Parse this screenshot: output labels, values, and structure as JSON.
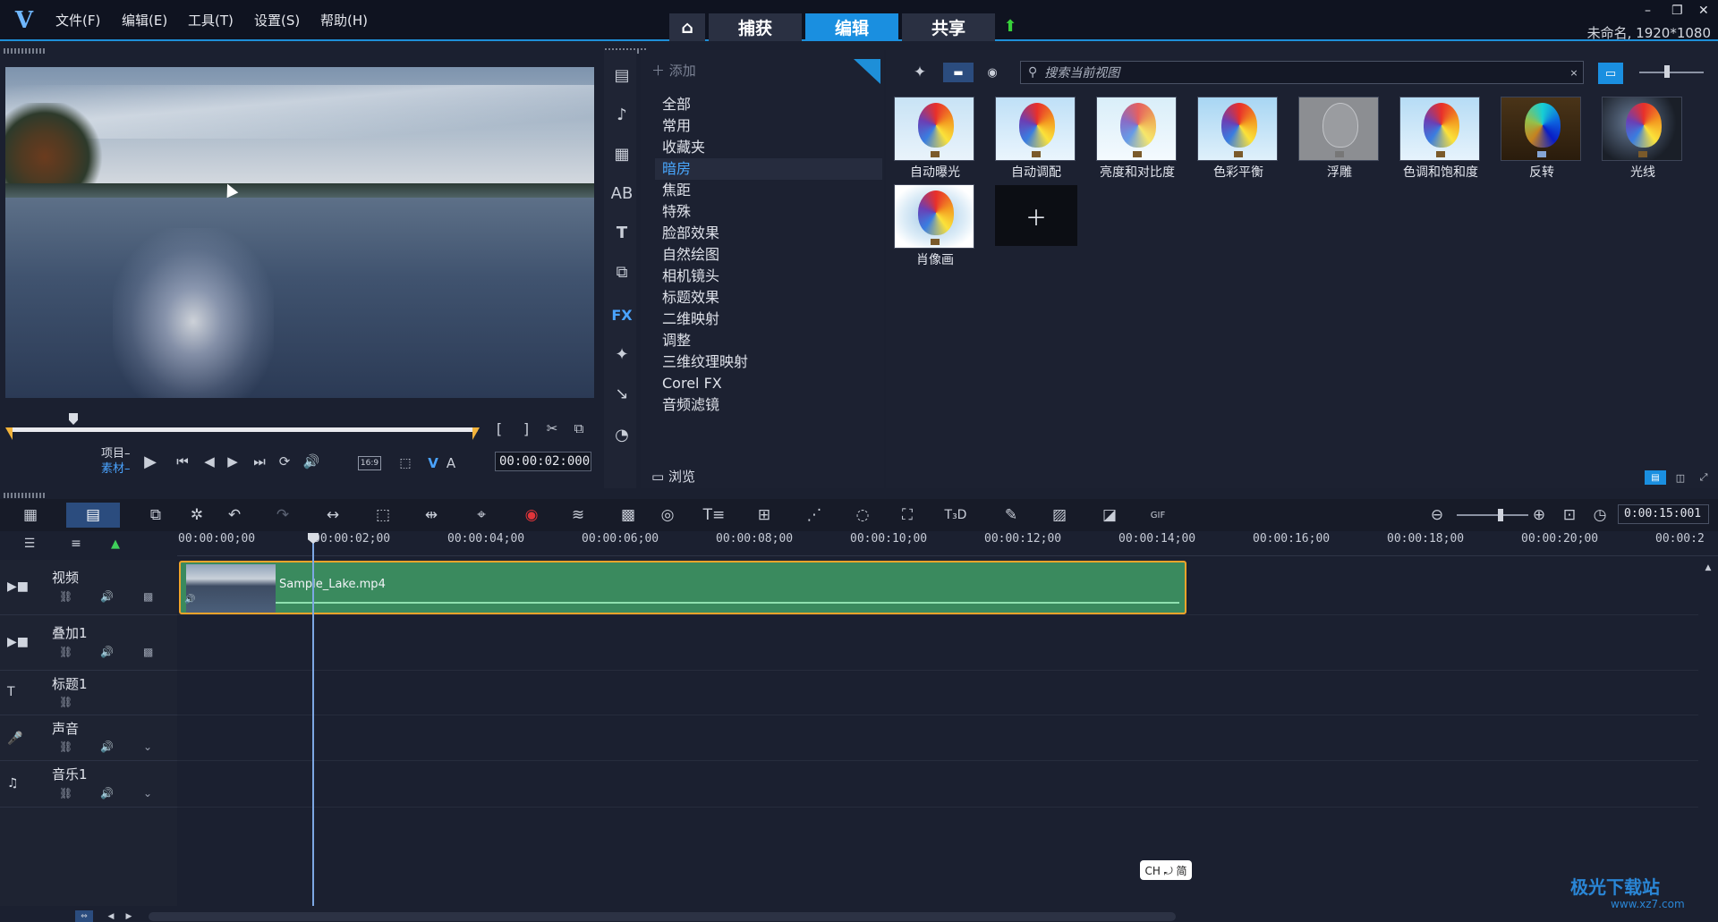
{
  "menu": [
    "文件(F)",
    "编辑(E)",
    "工具(T)",
    "设置(S)",
    "帮助(H)"
  ],
  "tabs": [
    "捕获",
    "编辑",
    "共享"
  ],
  "window_info": "未命名, 1920*1080",
  "player": {
    "project_label": "项目–",
    "clip_label": "素材–",
    "timecode": "00:00:02:000",
    "aspect": "16:9"
  },
  "library": {
    "add_label": "添加",
    "browse_label": "浏览",
    "search_placeholder": "搜索当前视图",
    "categories": [
      "全部",
      "常用",
      "收藏夹",
      "暗房",
      "焦距",
      "特殊",
      "脸部效果",
      "自然绘图",
      "相机镜头",
      "标题效果",
      "二维映射",
      "调整",
      "三维纹理映射",
      "Corel FX",
      "音频滤镜"
    ],
    "selected_category": "暗房",
    "effects": [
      "自动曝光",
      "自动调配",
      "亮度和对比度",
      "色彩平衡",
      "浮雕",
      "色调和饱和度",
      "反转",
      "光线",
      "肖像画"
    ]
  },
  "timeline": {
    "duration": "0:00:15:001",
    "ruler": [
      "00:00:00;00",
      "00:00:02;00",
      "00:00:04;00",
      "00:00:06;00",
      "00:00:08;00",
      "00:00:10;00",
      "00:00:12;00",
      "00:00:14;00",
      "00:00:16;00",
      "00:00:18;00",
      "00:00:20;00",
      "00:00:2"
    ],
    "tracks": [
      "视频",
      "叠加1",
      "标题1",
      "声音",
      "音乐1"
    ],
    "clip_name": "Sample_Lake.mp4"
  },
  "ime": "CH ⤾ 简",
  "watermark": "极光下载站",
  "watermark_url": "www.xz7.com",
  "colors": {
    "accent": "#1a8fe0",
    "clip": "#3a8a5e",
    "clip_border": "#f0a32a"
  }
}
